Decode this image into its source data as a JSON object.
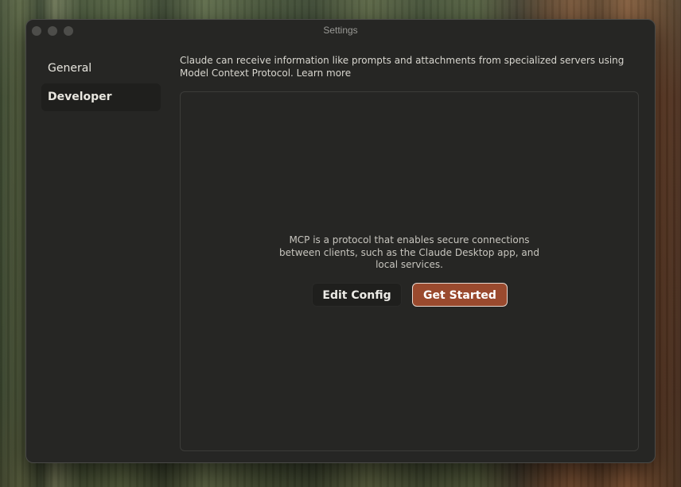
{
  "window": {
    "title": "Settings"
  },
  "sidebar": {
    "items": [
      {
        "label": "General",
        "active": false
      },
      {
        "label": "Developer",
        "active": true
      }
    ]
  },
  "main": {
    "description": "Claude can receive information like prompts and attachments from specialized servers using Model Context Protocol.",
    "learn_more": "Learn more",
    "panel": {
      "text": "MCP is a protocol that enables secure connections between clients, such as the Claude Desktop app, and local services.",
      "edit_config_label": "Edit Config",
      "get_started_label": "Get Started"
    }
  },
  "colors": {
    "accent": "#9a4a2e",
    "window_bg": "#262624"
  }
}
